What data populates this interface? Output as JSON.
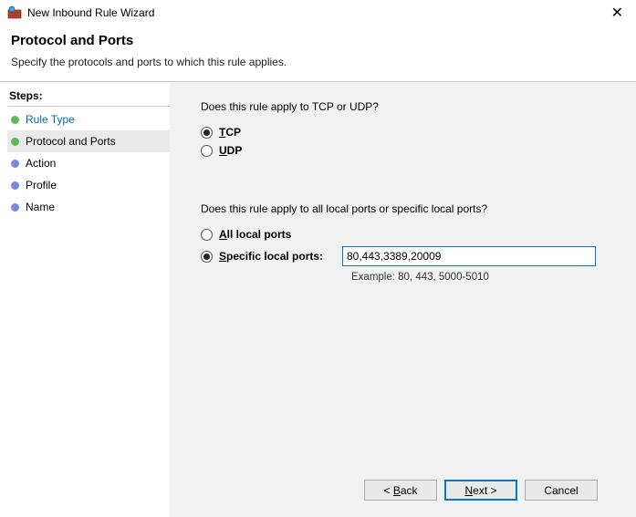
{
  "titlebar": {
    "title": "New Inbound Rule Wizard"
  },
  "header": {
    "title": "Protocol and Ports",
    "subtitle": "Specify the protocols and ports to which this rule applies."
  },
  "sidebar": {
    "heading": "Steps:",
    "items": [
      {
        "label": "Rule Type",
        "state": "completed"
      },
      {
        "label": "Protocol and Ports",
        "state": "current"
      },
      {
        "label": "Action",
        "state": "pending"
      },
      {
        "label": "Profile",
        "state": "pending"
      },
      {
        "label": "Name",
        "state": "pending"
      }
    ]
  },
  "main": {
    "protocol_question": "Does this rule apply to TCP or UDP?",
    "protocol_options": {
      "tcp_prefix": "T",
      "tcp_rest": "CP",
      "udp_prefix": "U",
      "udp_rest": "DP",
      "selected": "tcp"
    },
    "ports_question": "Does this rule apply to all local ports or specific local ports?",
    "ports_options": {
      "all_prefix": "A",
      "all_rest": "ll local ports",
      "specific_prefix": "S",
      "specific_rest": "pecific local ports:",
      "selected": "specific"
    },
    "ports_input_value": "80,443,3389,20009",
    "example_label": "Example: 80, 443, 5000-5010"
  },
  "footer": {
    "back_lt": "< ",
    "back_mn": "B",
    "back_rest": "ack",
    "next_mn": "N",
    "next_rest": "ext >",
    "cancel": "Cancel"
  }
}
